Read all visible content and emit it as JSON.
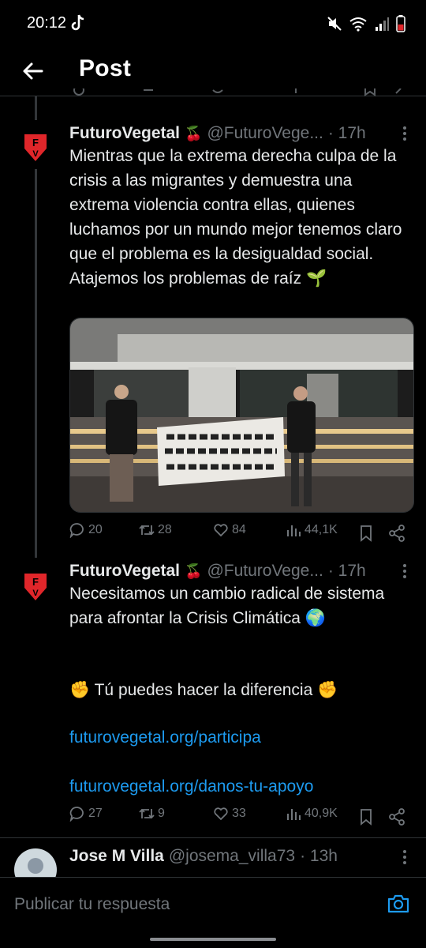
{
  "status_bar": {
    "time": "20:12"
  },
  "header": {
    "title": "Post"
  },
  "tweets": [
    {
      "name": "FuturoVegetal",
      "handle": "@FuturoVege...",
      "time": "· 17h",
      "text": "Mientras que la extrema derecha culpa de la crisis a las migrantes y demuestra una extrema violencia contra ellas, quienes luchamos por un mundo mejor tenemos claro que el problema es la desigualdad social. Atajemos los problemas de raíz 🌱",
      "replies": "20",
      "retweets": "28",
      "likes": "84",
      "views": "44,1K"
    },
    {
      "name": "FuturoVegetal",
      "handle": "@FuturoVege...",
      "time": "· 17h",
      "text": "Necesitamos un cambio radical de sistema para afrontar la Crisis Climática 🌍",
      "text2": "✊ Tú puedes hacer la diferencia ✊",
      "link1": "futurovegetal.org/participa",
      "link2": "futurovegetal.org/danos-tu-apoyo",
      "replies": "27",
      "retweets": "9",
      "likes": "33",
      "views": "40,9K"
    },
    {
      "name": "Jose M Villa",
      "handle": "@josema_villa73",
      "time": "· 13h"
    }
  ],
  "reply_bar": {
    "placeholder": "Publicar tu respuesta"
  },
  "colors": {
    "accent": "#1d9bf0",
    "brand_red": "#e0262a",
    "muted": "#71767b"
  }
}
